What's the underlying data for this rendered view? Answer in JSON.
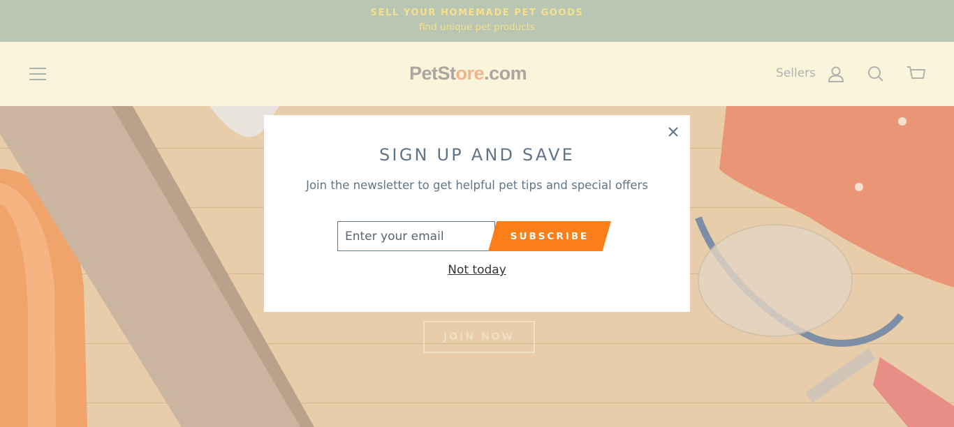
{
  "announcement": {
    "line1": "SELL YOUR HOMEMADE PET GOODS",
    "line2": "find unique pet products"
  },
  "header": {
    "logo_part1": "PetSt",
    "logo_part2": "ore",
    "logo_part3": ".com",
    "sellers_label": "Sellers",
    "icons": [
      "menu-icon",
      "user-icon",
      "search-icon",
      "cart-icon"
    ]
  },
  "hero": {
    "button_label": "JOIN NOW"
  },
  "modal": {
    "title": "SIGN UP AND SAVE",
    "subtitle": "Join the newsletter to get helpful pet tips and special offers",
    "email_placeholder": "Enter your email",
    "subscribe_label": "SUBSCRIBE",
    "dismiss_label": "Not today",
    "close_icon": "close-icon"
  },
  "colors": {
    "announcement_bg": "#b8c6b3",
    "header_bg": "#faf4da",
    "accent": "#fb7f18",
    "text": "#5f7587"
  }
}
